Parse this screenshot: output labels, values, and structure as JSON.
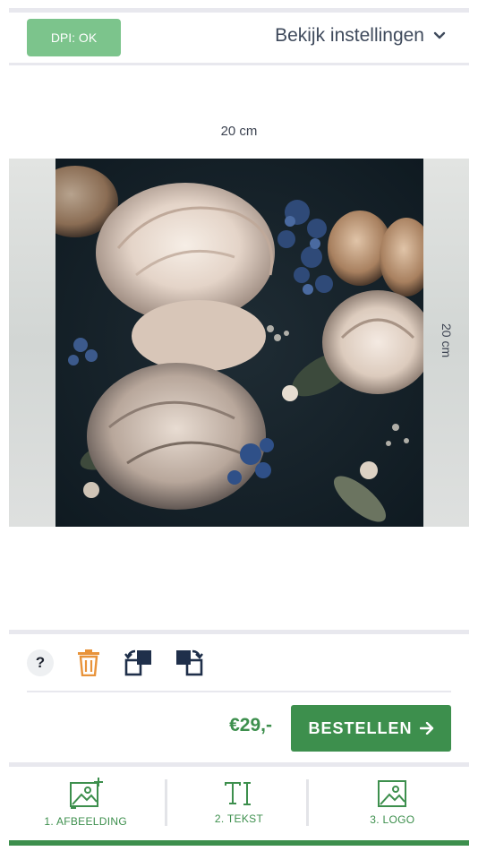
{
  "header": {
    "dpi_status": "DPI: OK",
    "settings_label": "Bekijk instellingen",
    "settings_icon": "chevron-down-icon"
  },
  "canvas": {
    "width_label": "20 cm",
    "height_label": "20 cm",
    "image": "dark-floral-peony-photo"
  },
  "toolbar": {
    "help_label": "?",
    "tools": [
      "help-icon",
      "trash-icon",
      "rotate-left-icon",
      "rotate-right-icon"
    ]
  },
  "order": {
    "price": "€29,-",
    "button_label": "BESTELLEN",
    "button_icon": "arrow-right-icon"
  },
  "tabs": [
    {
      "label": "1. AFBEELDING",
      "icon": "image-add-icon"
    },
    {
      "label": "2. TEKST",
      "icon": "text-cursor-icon"
    },
    {
      "label": "3. LOGO",
      "icon": "image-icon"
    }
  ],
  "colors": {
    "accent": "#3d8f4d",
    "badge": "#7cc48c",
    "trash": "#e8933a",
    "text": "#3f4a5c"
  }
}
